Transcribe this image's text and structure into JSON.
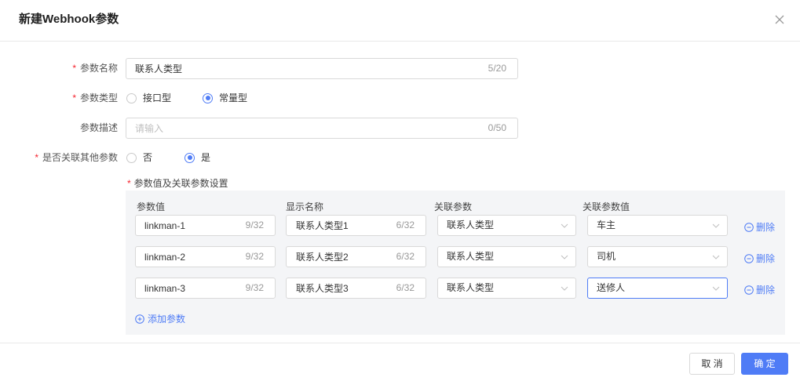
{
  "dialog": {
    "title": "新建Webhook参数"
  },
  "form": {
    "required_mark": "*",
    "name": {
      "label": "参数名称",
      "value": "联系人类型",
      "counter": "5/20"
    },
    "type": {
      "label": "参数类型",
      "options": [
        {
          "label": "接口型",
          "checked": false
        },
        {
          "label": "常量型",
          "checked": true
        }
      ]
    },
    "description": {
      "label": "参数描述",
      "placeholder": "请输入",
      "counter": "0/50"
    },
    "link_other": {
      "label": "是否关联其他参数",
      "options": [
        {
          "label": "否",
          "checked": false
        },
        {
          "label": "是",
          "checked": true
        }
      ]
    },
    "values": {
      "label": "参数值及关联参数设置",
      "columns": [
        "参数值",
        "显示名称",
        "关联参数",
        "关联参数值"
      ],
      "rows": [
        {
          "value": "linkman-1",
          "value_counter": "9/32",
          "display_name": "联系人类型1",
          "display_counter": "6/32",
          "related_param": "联系人类型",
          "related_value": "车主"
        },
        {
          "value": "linkman-2",
          "value_counter": "9/32",
          "display_name": "联系人类型2",
          "display_counter": "6/32",
          "related_param": "联系人类型",
          "related_value": "司机"
        },
        {
          "value": "linkman-3",
          "value_counter": "9/32",
          "display_name": "联系人类型3",
          "display_counter": "6/32",
          "related_param": "联系人类型",
          "related_value": "送修人"
        }
      ],
      "delete_label": "删除",
      "add_label": "添加参数"
    }
  },
  "footer": {
    "cancel_label": "取 消",
    "confirm_label": "确 定"
  },
  "colors": {
    "primary": "#4f7cf6",
    "required": "#f5222d"
  },
  "icons": {
    "close": "close-icon",
    "delete": "minus-circle-icon",
    "add": "plus-circle-icon",
    "dropdown": "chevron-down-icon"
  }
}
